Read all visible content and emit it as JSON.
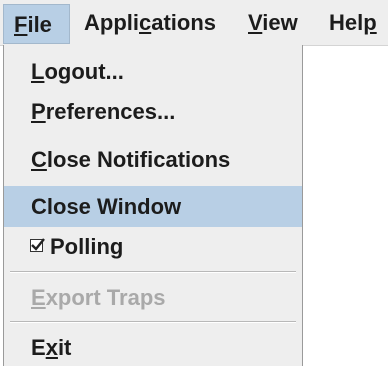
{
  "menubar": {
    "items": [
      {
        "label": "File",
        "mnemonic_index": 0,
        "active": true
      },
      {
        "label": "Applications",
        "mnemonic_index": 5,
        "active": false
      },
      {
        "label": "View",
        "mnemonic_index": 0,
        "active": false
      },
      {
        "label": "Help",
        "mnemonic_index": 3,
        "active": false
      }
    ]
  },
  "file_menu": {
    "items": [
      {
        "label": "Logout...",
        "mnemonic_index": 0,
        "enabled": true
      },
      {
        "label": "Preferences...",
        "mnemonic_index": 0,
        "enabled": true
      },
      {
        "label": "Close Notifications",
        "mnemonic_index": 0,
        "enabled": true
      },
      {
        "label": "Close Window",
        "mnemonic_index": -1,
        "enabled": true,
        "highlighted": true
      },
      {
        "label": "Polling",
        "mnemonic_index": -1,
        "enabled": true,
        "checkbox": true,
        "checked": true
      },
      {
        "label": "Export Traps",
        "mnemonic_index": 0,
        "enabled": false
      },
      {
        "label": "Exit",
        "mnemonic_index": 1,
        "enabled": true
      }
    ]
  },
  "colors": {
    "menu_background": "#eeeeee",
    "highlight": "#b8cfe5",
    "text": "#1c1c1c",
    "disabled_text": "#a9a9a9"
  }
}
